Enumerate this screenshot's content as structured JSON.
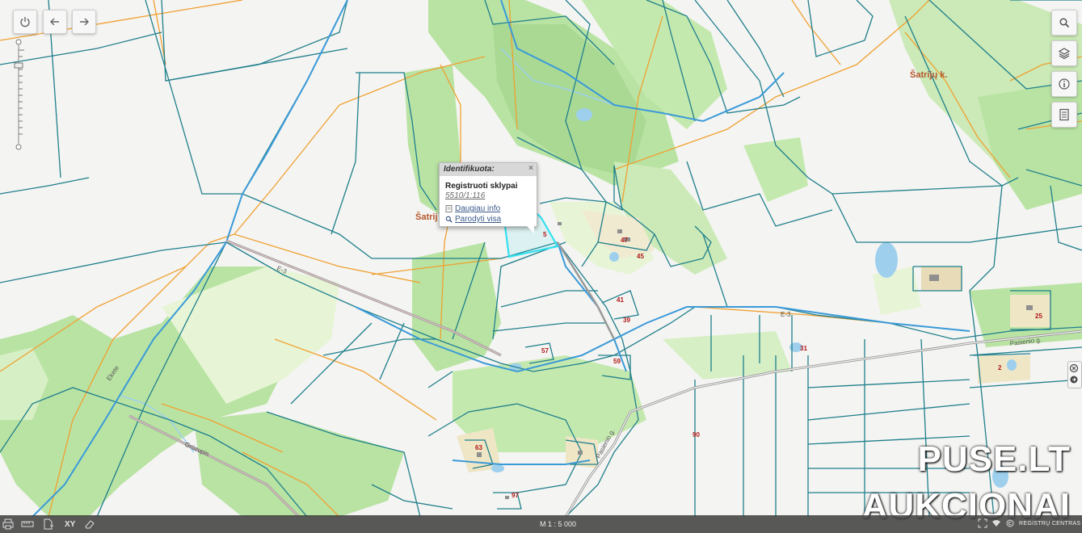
{
  "popup": {
    "header": "Identifikuota:",
    "close": "×",
    "layer": "Registruoti sklypai",
    "parcel_id": "5510/1:116",
    "more_info": "Daugiau info",
    "show_all": "Parodyti visa"
  },
  "map_labels": {
    "place_1": "Šatrij",
    "place_2": "Šatrijų k.",
    "road_e3_a": "E-3",
    "road_e3_b": "E-3",
    "pasienio_1": "Pasienio g.",
    "pasienio_2": "Pasienio g.",
    "river_1": "Ekete",
    "river_2": "Grūzupis",
    "n5": "5",
    "n47": "47",
    "n45": "45",
    "n41": "41",
    "n39": "39",
    "n57": "57",
    "n59": "59",
    "n31": "31",
    "n25": "25",
    "n2": "2",
    "n63": "63",
    "n90": "90",
    "n97": "97"
  },
  "scale": "M 1 : 5 000",
  "footer_brand": "REGISTRŲ CENTRAS",
  "watermark": {
    "line1": "PUSE.LT",
    "line2": "AUKCIONAI"
  },
  "icons": {
    "power": "power-icon",
    "back": "arrow-left-icon",
    "forward": "arrow-right-icon",
    "search": "search-icon",
    "layers": "layers-icon",
    "info": "info-icon",
    "doc": "document-icon"
  },
  "colors": {
    "parcel_line": "#1f7f8c",
    "orange_line": "#f0a030",
    "forest": "#b9e3a3",
    "meadow": "#e7f5d6",
    "water": "#9ed0ee",
    "selected": "#33e0f0",
    "house_label": "#b01818"
  }
}
